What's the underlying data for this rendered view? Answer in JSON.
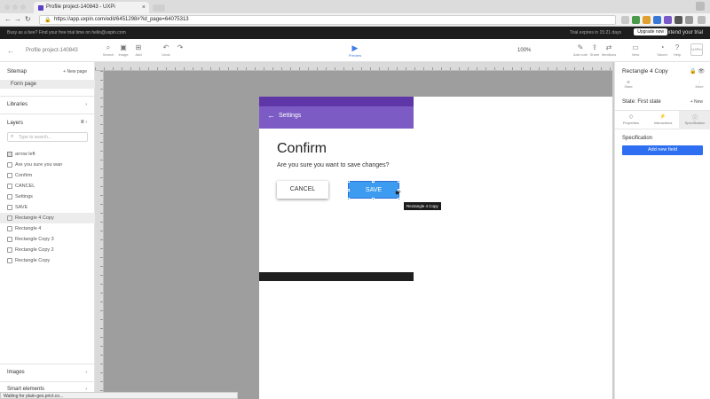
{
  "browser": {
    "tab_title": "Profile project-140843 - UXPi",
    "tab_close": "×",
    "url": "https://app.uxpin.com/edit/6451298#?id_page=64075313",
    "lock_icon": "🔒"
  },
  "trialbar": {
    "left_text": "Busy as a bee? Find your free trial time on hello@uxpin.com",
    "right_text": "Trial expires in 15:21 days",
    "upgrade_label": "Upgrade now",
    "extend_label": "Extend your trial"
  },
  "editor": {
    "back_icon": "←",
    "project_name": "Profile project-140843",
    "tools": [
      {
        "icon": "⌕",
        "label": "Search"
      },
      {
        "icon": "▣",
        "label": "Image"
      },
      {
        "icon": "⊞",
        "label": "Add"
      },
      {
        "icon": "↶",
        "label": "Undo"
      },
      {
        "icon": "↷",
        "label": ""
      }
    ],
    "preview_icon": "▶",
    "preview_label": "Preview",
    "zoom": "100%",
    "right_tools": [
      {
        "icon": "✎",
        "label": "Add note"
      },
      {
        "icon": "⇪",
        "label": "Share"
      },
      {
        "icon": "⇄",
        "label": "Iterations"
      },
      {
        "icon": "▭",
        "label": "View"
      },
      {
        "icon": "◔",
        "label": "Saved"
      },
      {
        "icon": "?",
        "label": "Help"
      }
    ],
    "avatar_text": "UXPin"
  },
  "sidebar": {
    "sitemap_label": "Sitemap",
    "new_page_label": "+ New page",
    "page_item": "Form page",
    "libraries_label": "Libraries",
    "layers_label": "Layers",
    "search_placeholder": "Type to search...",
    "layers": [
      {
        "label": "arrow left",
        "selected": false
      },
      {
        "label": "Are you sure you wan",
        "selected": false
      },
      {
        "label": "Confirm",
        "selected": false
      },
      {
        "label": "CANCEL",
        "selected": false
      },
      {
        "label": "Settings",
        "selected": false
      },
      {
        "label": "SAVE",
        "selected": false
      },
      {
        "label": "Rectangle 4 Copy",
        "selected": true
      },
      {
        "label": "Rectangle 4",
        "selected": false
      },
      {
        "label": "Rectangle Copy 3",
        "selected": false
      },
      {
        "label": "Rectangle Copy 2",
        "selected": false
      },
      {
        "label": "Rectangle Copy",
        "selected": false
      }
    ],
    "images_label": "Images",
    "smart_label": "Smart elements",
    "status_tip": "Waiting for plain-ges.prict.co..."
  },
  "canvas": {
    "header_title": "Settings",
    "header_arrow": "←",
    "dialog_title": "Confirm",
    "dialog_body": "Are you sure you want to save changes?",
    "cancel_label": "CANCEL",
    "save_label": "SAVE",
    "tooltip": "Rectangle 4 Copy",
    "cursor": "☛"
  },
  "rpanel": {
    "element_name": "Rectangle 4 Copy",
    "icons": "🔒 👁",
    "state_label": "State: First state",
    "new_label": "+ New",
    "tabs": [
      {
        "icon": "◇",
        "label": "Properties"
      },
      {
        "icon": "⚡",
        "label": "Interactions"
      },
      {
        "icon": "ⓘ",
        "label": "Specification"
      }
    ],
    "spec_label": "Specification",
    "add_field_label": "Add new field"
  },
  "colors": {
    "purple_header": "#7c5cc4",
    "purple_dark": "#5e36a8",
    "save_blue": "#3d9cf0",
    "accent_blue": "#2d6ff0"
  }
}
